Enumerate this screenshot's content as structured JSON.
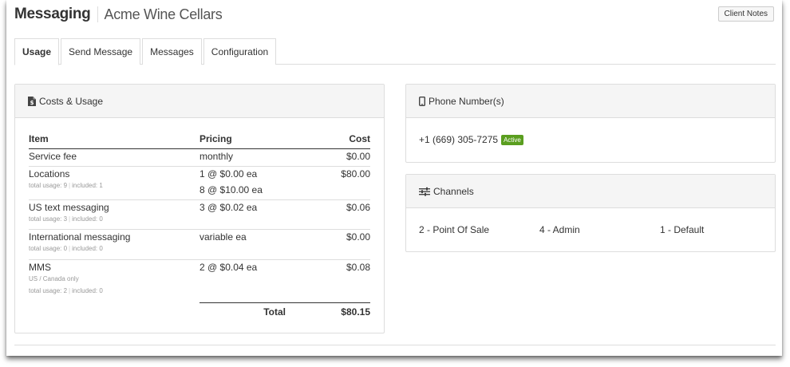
{
  "header": {
    "app_title": "Messaging",
    "client_name": "Acme Wine Cellars",
    "client_notes_label": "Client Notes"
  },
  "tabs": [
    {
      "label": "Usage",
      "active": true
    },
    {
      "label": "Send Message",
      "active": false
    },
    {
      "label": "Messages",
      "active": false
    },
    {
      "label": "Configuration",
      "active": false
    }
  ],
  "costs": {
    "heading": "Costs & Usage",
    "icon": "file-dollar-icon",
    "columns": {
      "item": "Item",
      "pricing": "Pricing",
      "cost": "Cost"
    },
    "rows": [
      {
        "item": "Service fee",
        "pricing": "monthly",
        "cost": "$0.00"
      },
      {
        "item": "Locations",
        "usage": "total usage: 9",
        "included": "included: 1",
        "pricing": "1 @ $0.00 ea",
        "pricing2": "8 @ $10.00 ea",
        "cost": "$80.00"
      },
      {
        "item": "US text messaging",
        "usage": "total usage: 3",
        "included": "included: 0",
        "pricing": "3 @ $0.02 ea",
        "cost": "$0.06"
      },
      {
        "item": "International messaging",
        "usage": "total usage: 0",
        "included": "included: 0",
        "pricing": "variable ea",
        "cost": "$0.00"
      },
      {
        "item": "MMS",
        "note": "US / Canada only",
        "usage": "total usage: 2",
        "included": "included: 0",
        "pricing": "2 @ $0.04 ea",
        "cost": "$0.08"
      }
    ],
    "total_label": "Total",
    "total_value": "$80.15"
  },
  "phone": {
    "heading": "Phone Number(s)",
    "icon": "mobile-phone-icon",
    "number": "+1 (669) 305-7275",
    "status": "Active",
    "status_color": "#5a9e1f"
  },
  "channels": {
    "heading": "Channels",
    "icon": "sliders-icon",
    "items": [
      "2 - Point Of Sale",
      "4 - Admin",
      "1 - Default"
    ]
  }
}
